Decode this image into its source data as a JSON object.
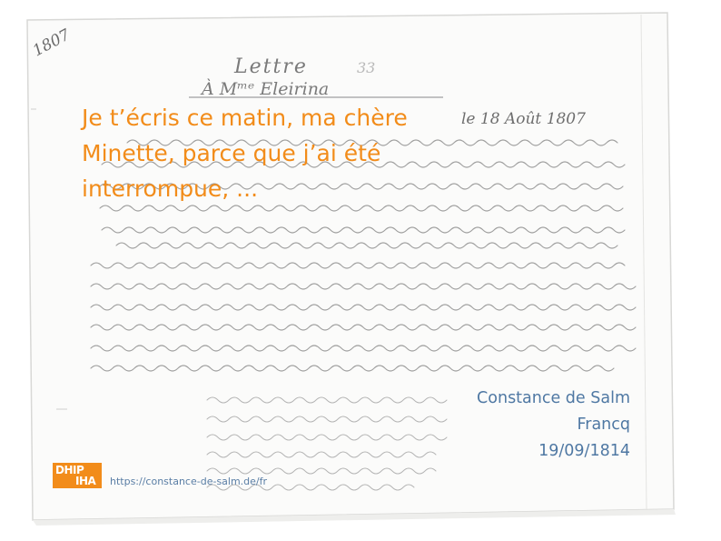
{
  "letter": {
    "year_note": "1807",
    "heading": "Lettre",
    "addressee": "À Mᵐᵉ Eleirina",
    "date_line": "le 18 Août 1807"
  },
  "quote": "Je t’écris ce matin, ma chère\nMinette, parce que j’ai été\ninterrompue, ...",
  "meta": {
    "author": "Constance de Salm",
    "recipient": "Francq",
    "date": "19/09/1814"
  },
  "logo": {
    "line1": "DHIP",
    "line2": "IHA"
  },
  "link": {
    "url": "https://constance-de-salm.de/fr"
  },
  "colors": {
    "accent": "#f28c1a",
    "meta_text": "#4f78a3",
    "ink": "#5a5a5a",
    "paper": "#fbfbfa"
  }
}
